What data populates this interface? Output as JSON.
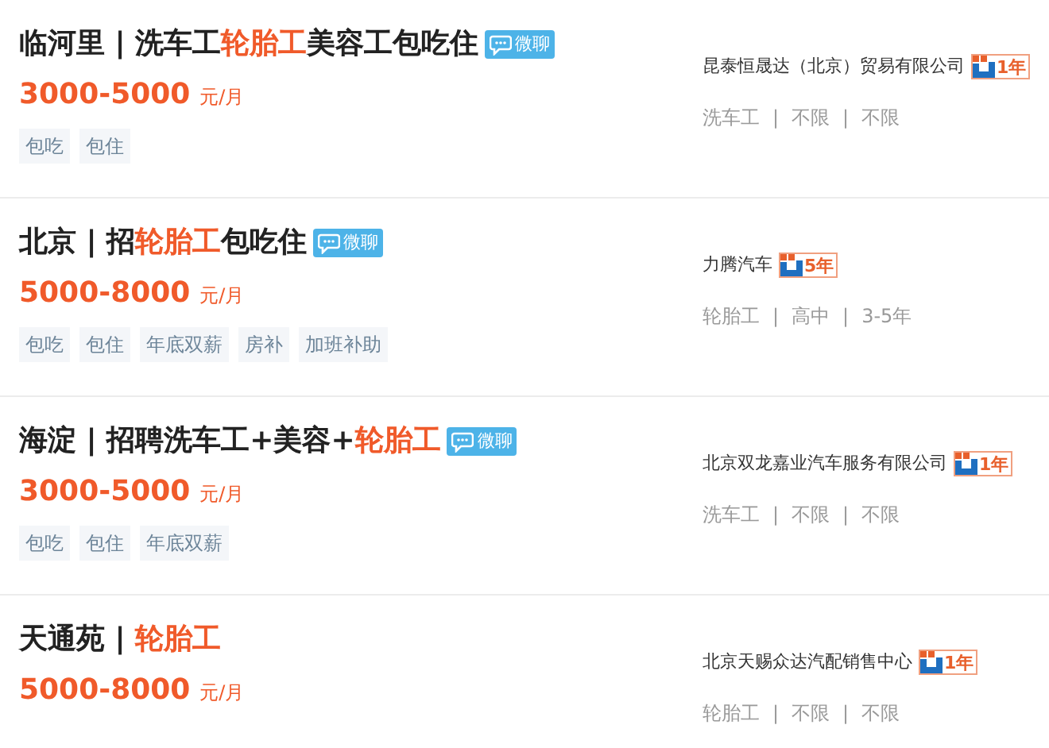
{
  "jobs": [
    {
      "title": [
        {
          "text": "临河里 | 洗车工",
          "highlight": false
        },
        {
          "text": "轮胎工",
          "highlight": true
        },
        {
          "text": "美容工包吃住",
          "highlight": false
        }
      ],
      "chat_badge": "微聊",
      "salary": "3000-5000",
      "salary_unit": "元/月",
      "tags": [
        "包吃",
        "包住"
      ],
      "company": "昆泰恒晟达（北京）贸易有限公司",
      "years_badge": "1年",
      "meta": [
        "洗车工",
        "|",
        "不限",
        "|",
        "不限"
      ]
    },
    {
      "title": [
        {
          "text": "北京 | 招",
          "highlight": false
        },
        {
          "text": "轮胎工",
          "highlight": true
        },
        {
          "text": "包吃住",
          "highlight": false
        }
      ],
      "chat_badge": "微聊",
      "salary": "5000-8000",
      "salary_unit": "元/月",
      "tags": [
        "包吃",
        "包住",
        "年底双薪",
        "房补",
        "加班补助"
      ],
      "company": "力腾汽车",
      "years_badge": "5年",
      "meta": [
        "轮胎工",
        "|",
        "高中",
        "|",
        "3-5年"
      ]
    },
    {
      "title": [
        {
          "text": "海淀 | 招聘洗车工+美容+",
          "highlight": false
        },
        {
          "text": "轮胎工",
          "highlight": true
        }
      ],
      "chat_badge": "微聊",
      "salary": "3000-5000",
      "salary_unit": "元/月",
      "tags": [
        "包吃",
        "包住",
        "年底双薪"
      ],
      "company": "北京双龙嘉业汽车服务有限公司",
      "years_badge": "1年",
      "meta": [
        "洗车工",
        "|",
        "不限",
        "|",
        "不限"
      ]
    },
    {
      "title": [
        {
          "text": "天通苑 | ",
          "highlight": false
        },
        {
          "text": "轮胎工",
          "highlight": true
        }
      ],
      "salary": "5000-8000",
      "salary_unit": "元/月",
      "company": "北京天赐众达汽配销售中心",
      "years_badge": "1年",
      "meta": [
        "轮胎工",
        "|",
        "不限",
        "|",
        "不限"
      ]
    }
  ]
}
